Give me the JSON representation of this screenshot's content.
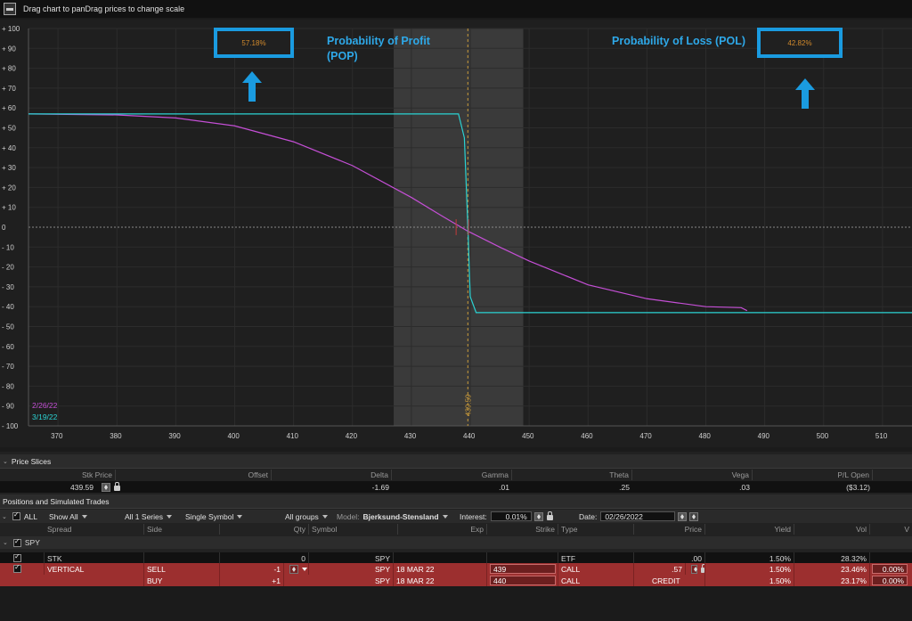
{
  "topbar": {
    "message": "Drag chart to panDrag prices to change scale",
    "icon": "chart-icon"
  },
  "chart": {
    "pop_value": "57.18%",
    "pol_value": "42.82%",
    "pop_label_line1": "Probability of Profit",
    "pop_label_line2": "(POP)",
    "pol_label": "Probability of Loss (POL)",
    "legend_date1": "2/26/22",
    "legend_date2": "3/19/22",
    "price_marker": "439.59",
    "colors": {
      "curve_now": "#c54fd6",
      "curve_exp": "#2bd3d3",
      "annotation": "#1a9be0",
      "price_line": "#c99a3a"
    }
  },
  "chart_data": {
    "type": "line",
    "title": "",
    "xlabel": "",
    "ylabel": "",
    "xlim": [
      365,
      515
    ],
    "ylim": [
      -100,
      100
    ],
    "x_ticks": [
      370,
      380,
      390,
      400,
      410,
      420,
      430,
      440,
      450,
      460,
      470,
      480,
      490,
      500,
      510
    ],
    "y_ticks": [
      "+ 100",
      "+ 90",
      "+ 80",
      "+ 70",
      "+ 60",
      "+ 50",
      "+ 40",
      "+ 30",
      "+ 20",
      "+ 10",
      "0",
      "- 10",
      "- 20",
      "- 30",
      "- 40",
      "- 50",
      "- 60",
      "- 70",
      "- 80",
      "- 90",
      "- 100"
    ],
    "shaded_range": [
      427,
      449
    ],
    "current_price": 439.59,
    "series": [
      {
        "name": "2/26/22",
        "x": [
          365,
          380,
          390,
          400,
          410,
          420,
          430,
          435,
          439.59,
          445,
          450,
          460,
          470,
          480,
          486,
          487
        ],
        "y": [
          57,
          56.5,
          55,
          51,
          43,
          31,
          15,
          6,
          -2,
          -10,
          -17,
          -29,
          -36,
          -40,
          -40.5,
          -42
        ]
      },
      {
        "name": "3/19/22",
        "x": [
          365,
          438,
          439,
          439.6,
          440,
          441,
          515
        ],
        "y": [
          57,
          57,
          45,
          0,
          -35,
          -43,
          -43
        ]
      }
    ]
  },
  "price_slices": {
    "title": "Price Slices",
    "headers": [
      "Stk Price",
      "Offset",
      "Delta",
      "Gamma",
      "Theta",
      "Vega",
      "P/L Open"
    ],
    "values": {
      "stk_price": "439.59",
      "delta": "-1.69",
      "gamma": ".01",
      "theta": ".25",
      "vega": ".03",
      "pl_open": "($3.12)"
    }
  },
  "positions": {
    "title": "Positions and Simulated Trades",
    "toolbar": {
      "all": "ALL",
      "show": "Show All",
      "series": "All 1 Series",
      "symbol_mode": "Single Symbol",
      "groups": "All groups",
      "model_label": "Model:",
      "model_value": "Bjerksund-Stensland",
      "interest_label": "Interest:",
      "interest_value": "0.01%",
      "date_label": "Date:",
      "date_value": "02/26/2022"
    },
    "columns": [
      "Spread",
      "Side",
      "Qty",
      "Symbol",
      "Exp",
      "Strike",
      "Type",
      "Price",
      "Yield",
      "Vol",
      "V"
    ],
    "group": "SPY",
    "rows": [
      {
        "spread": "STK",
        "side": "",
        "qty": "0",
        "symbol": "SPY",
        "exp": "",
        "strike": "",
        "type": "ETF",
        "price": ".00",
        "yield": "1.50%",
        "vol": "28.32%",
        "extra": ""
      },
      {
        "spread": "VERTICAL",
        "side": "SELL",
        "qty": "-1",
        "symbol": "SPY",
        "exp": "18 MAR 22",
        "strike": "439",
        "type": "CALL",
        "price": ".57",
        "yield": "1.50%",
        "vol": "23.46%",
        "extra": "0.00%"
      },
      {
        "spread": "",
        "side": "BUY",
        "qty": "+1",
        "symbol": "SPY",
        "exp": "18 MAR 22",
        "strike": "440",
        "type": "CALL",
        "price": "CREDIT",
        "yield": "1.50%",
        "vol": "23.17%",
        "extra": "0.00%"
      }
    ]
  }
}
